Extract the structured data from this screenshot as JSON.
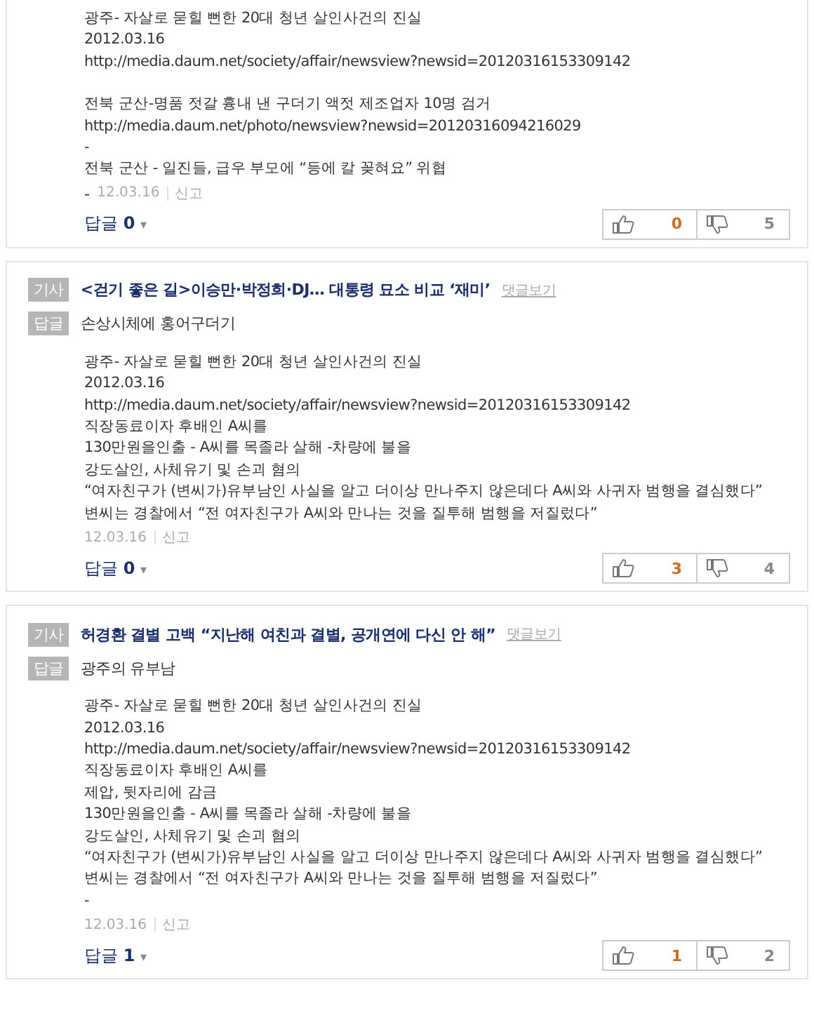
{
  "comments": [
    {
      "top_cut": true,
      "paragraphs": [
        [
          "광주- 자살로 묻힐 뻔한 20대 청년 살인사건의 진실",
          "2012.03.16",
          "http://media.daum.net/society/affair/newsview?newsid=20120316153309142"
        ],
        [
          "전북 군산-명품 젓갈 흉내 낸 구더기 액젓 제조업자 10명 검거",
          "http://media.daum.net/photo/newsview?newsid=20120316094216029",
          "-",
          "전북 군산 - 일진들, 급우 부모에 “등에 칼 꽂혀요” 위협"
        ]
      ],
      "lead": "-",
      "date": "12.03.16",
      "report": "신고",
      "replies_label": "답글",
      "replies_count": "0",
      "caret": "▾",
      "likes": "0",
      "dislikes": "5"
    },
    {
      "top_cut": false,
      "article": {
        "tag": "기사",
        "title": "<걷기 좋은 길>이승만·박정희·DJ… 대통령 묘소 비교 ‘재미’",
        "link": "댓글보기"
      },
      "reply": {
        "tag": "답글",
        "title": "손상시체에 홍어구더기"
      },
      "paragraphs": [
        [
          "광주- 자살로 묻힐 뻔한 20대 청년 살인사건의 진실",
          "2012.03.16",
          "http://media.daum.net/society/affair/newsview?newsid=20120316153309142",
          "직장동료이자 후배인 A씨를",
          "130만원을인출 - A씨를 목졸라 살해 -차량에 불을",
          "강도살인, 사체유기 및 손괴 혐의",
          "“여자친구가 (변씨가)유부남인 사실을 알고 더이상 만나주지 않은데다 A씨와 사귀자 범행을 결심했다”",
          "변씨는 경찰에서 “전 여자친구가 A씨와 만나는 것을 질투해 범행을 저질렀다”"
        ]
      ],
      "date": "12.03.16",
      "report": "신고",
      "replies_label": "답글",
      "replies_count": "0",
      "caret": "▾",
      "likes": "3",
      "dislikes": "4"
    },
    {
      "top_cut": false,
      "article": {
        "tag": "기사",
        "title": "허경환 결별 고백 “지난해 여친과 결별, 공개연에 다신 안 해”",
        "link": "댓글보기"
      },
      "reply": {
        "tag": "답글",
        "title": "광주의 유부남"
      },
      "paragraphs": [
        [
          "광주- 자살로 묻힐 뻔한 20대 청년 살인사건의 진실",
          "2012.03.16",
          "http://media.daum.net/society/affair/newsview?newsid=20120316153309142",
          "직장동료이자 후배인 A씨를",
          "제압, 뒷자리에 감금",
          "130만원을인출 - A씨를 목졸라 살해 -차량에 불을",
          "강도살인, 사체유기 및 손괴 혐의",
          "“여자친구가 (변씨가)유부남인 사실을 알고 더이상 만나주지 않은데다 A씨와 사귀자 범행을 결심했다”",
          "변씨는 경찰에서 “전 여자친구가 A씨와 만나는 것을 질투해 범행을 저질렀다”",
          "-"
        ]
      ],
      "date": "12.03.16",
      "report": "신고",
      "replies_label": "답글",
      "replies_count": "1",
      "caret": "▾",
      "likes": "1",
      "dislikes": "2"
    }
  ]
}
